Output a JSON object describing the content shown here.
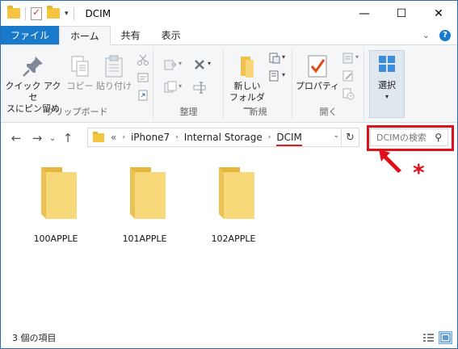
{
  "window": {
    "title": "DCIM",
    "controls": {
      "minimize": "—",
      "maximize": "☐",
      "close": "✕"
    }
  },
  "ribbon_tabs": [
    {
      "label": "ファイル",
      "state": "file"
    },
    {
      "label": "ホーム",
      "state": "active"
    },
    {
      "label": "共有",
      "state": "normal"
    },
    {
      "label": "表示",
      "state": "normal"
    }
  ],
  "ribbon": {
    "clipboard": {
      "pin_label_1": "クイック アクセ",
      "pin_label_2": "スにピン留め",
      "copy_label": "コピー",
      "paste_label": "貼り付け",
      "group_label": "クリップボード"
    },
    "organize": {
      "group_label": "整理"
    },
    "new": {
      "new_folder_1": "新しい",
      "new_folder_2": "フォルダー",
      "group_label": "新規"
    },
    "open": {
      "properties_label": "プロパティ",
      "group_label": "開く"
    },
    "select": {
      "label": "選択"
    }
  },
  "nav": {
    "back": "←",
    "forward": "→",
    "recent": "⌄",
    "up": "↑"
  },
  "address": {
    "overflow": "«",
    "crumbs": [
      "iPhone7",
      "Internal Storage",
      "DCIM"
    ],
    "separator": "›",
    "refresh": "↻"
  },
  "search": {
    "placeholder": "DCIMの検索",
    "icon": "⚲"
  },
  "annotation": {
    "asterisk": "*"
  },
  "folders": [
    {
      "name": "100APPLE"
    },
    {
      "name": "101APPLE"
    },
    {
      "name": "102APPLE"
    }
  ],
  "status": {
    "item_count": "3 個の項目"
  },
  "colors": {
    "accent": "#1979ca",
    "highlight": "#e0101a",
    "folder": "#f5c542"
  }
}
